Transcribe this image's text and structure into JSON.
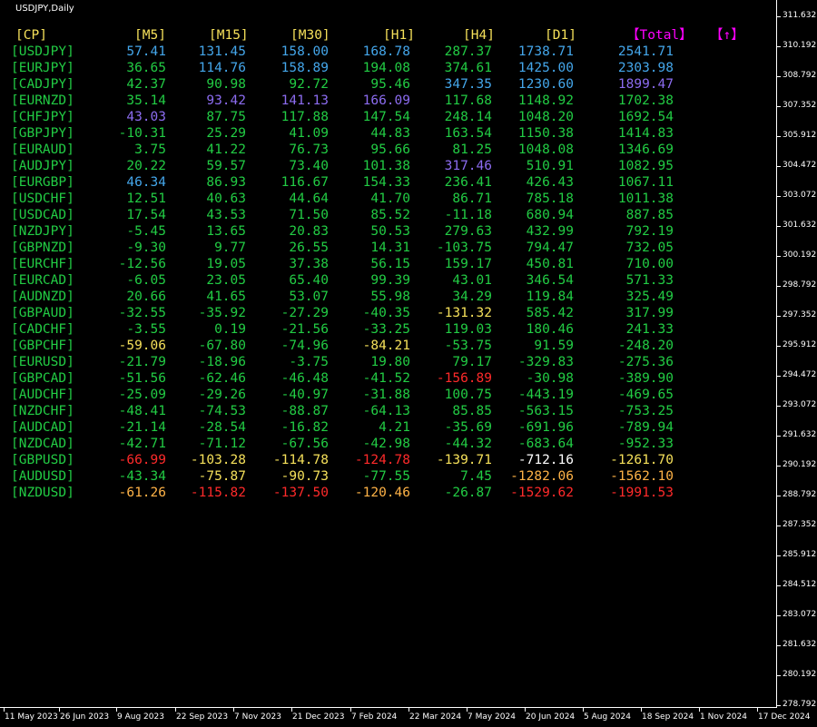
{
  "chart_title": "USDJPY,Daily",
  "colors": {
    "green": "#22cc44",
    "yellow": "#f5e05a",
    "blue": "#44a6ea",
    "purple": "#8c6cf0",
    "red": "#ff2a2a",
    "orange": "#ffb347",
    "magenta": "#ff00ff",
    "white": "#ffffff"
  },
  "headers": [
    {
      "text": "[CP]",
      "color": "yellow"
    },
    {
      "text": "[M5]",
      "color": "yellow"
    },
    {
      "text": "[M15]",
      "color": "yellow"
    },
    {
      "text": "[M30]",
      "color": "yellow"
    },
    {
      "text": "[H1]",
      "color": "yellow"
    },
    {
      "text": "[H4]",
      "color": "yellow"
    },
    {
      "text": "[D1]",
      "color": "yellow"
    },
    {
      "text": "【Total】",
      "color": "magenta"
    },
    {
      "text": "【↑】",
      "color": "magenta"
    }
  ],
  "rows": [
    {
      "sym": "[USDJPY]",
      "v": [
        [
          "57.41",
          "blue"
        ],
        [
          "131.45",
          "blue"
        ],
        [
          "158.00",
          "blue"
        ],
        [
          "168.78",
          "blue"
        ],
        [
          "287.37",
          "green"
        ],
        [
          "1738.71",
          "blue"
        ],
        [
          "2541.71",
          "blue"
        ]
      ]
    },
    {
      "sym": "[EURJPY]",
      "v": [
        [
          "36.65",
          "green"
        ],
        [
          "114.76",
          "blue"
        ],
        [
          "158.89",
          "blue"
        ],
        [
          "194.08",
          "green"
        ],
        [
          "374.61",
          "green"
        ],
        [
          "1425.00",
          "blue"
        ],
        [
          "2303.98",
          "blue"
        ]
      ]
    },
    {
      "sym": "[CADJPY]",
      "v": [
        [
          "42.37",
          "green"
        ],
        [
          "90.98",
          "green"
        ],
        [
          "92.72",
          "green"
        ],
        [
          "95.46",
          "green"
        ],
        [
          "347.35",
          "blue"
        ],
        [
          "1230.60",
          "blue"
        ],
        [
          "1899.47",
          "purple"
        ]
      ]
    },
    {
      "sym": "[EURNZD]",
      "v": [
        [
          "35.14",
          "green"
        ],
        [
          "93.42",
          "purple"
        ],
        [
          "141.13",
          "purple"
        ],
        [
          "166.09",
          "purple"
        ],
        [
          "117.68",
          "green"
        ],
        [
          "1148.92",
          "green"
        ],
        [
          "1702.38",
          "green"
        ]
      ]
    },
    {
      "sym": "[CHFJPY]",
      "v": [
        [
          "43.03",
          "purple"
        ],
        [
          "87.75",
          "green"
        ],
        [
          "117.88",
          "green"
        ],
        [
          "147.54",
          "green"
        ],
        [
          "248.14",
          "green"
        ],
        [
          "1048.20",
          "green"
        ],
        [
          "1692.54",
          "green"
        ]
      ]
    },
    {
      "sym": "[GBPJPY]",
      "v": [
        [
          "-10.31",
          "green"
        ],
        [
          "25.29",
          "green"
        ],
        [
          "41.09",
          "green"
        ],
        [
          "44.83",
          "green"
        ],
        [
          "163.54",
          "green"
        ],
        [
          "1150.38",
          "green"
        ],
        [
          "1414.83",
          "green"
        ]
      ]
    },
    {
      "sym": "[EURAUD]",
      "v": [
        [
          "3.75",
          "green"
        ],
        [
          "41.22",
          "green"
        ],
        [
          "76.73",
          "green"
        ],
        [
          "95.66",
          "green"
        ],
        [
          "81.25",
          "green"
        ],
        [
          "1048.08",
          "green"
        ],
        [
          "1346.69",
          "green"
        ]
      ]
    },
    {
      "sym": "[AUDJPY]",
      "v": [
        [
          "20.22",
          "green"
        ],
        [
          "59.57",
          "green"
        ],
        [
          "73.40",
          "green"
        ],
        [
          "101.38",
          "green"
        ],
        [
          "317.46",
          "purple"
        ],
        [
          "510.91",
          "green"
        ],
        [
          "1082.95",
          "green"
        ]
      ]
    },
    {
      "sym": "[EURGBP]",
      "v": [
        [
          "46.34",
          "blue"
        ],
        [
          "86.93",
          "green"
        ],
        [
          "116.67",
          "green"
        ],
        [
          "154.33",
          "green"
        ],
        [
          "236.41",
          "green"
        ],
        [
          "426.43",
          "green"
        ],
        [
          "1067.11",
          "green"
        ]
      ]
    },
    {
      "sym": "[USDCHF]",
      "v": [
        [
          "12.51",
          "green"
        ],
        [
          "40.63",
          "green"
        ],
        [
          "44.64",
          "green"
        ],
        [
          "41.70",
          "green"
        ],
        [
          "86.71",
          "green"
        ],
        [
          "785.18",
          "green"
        ],
        [
          "1011.38",
          "green"
        ]
      ]
    },
    {
      "sym": "[USDCAD]",
      "v": [
        [
          "17.54",
          "green"
        ],
        [
          "43.53",
          "green"
        ],
        [
          "71.50",
          "green"
        ],
        [
          "85.52",
          "green"
        ],
        [
          "-11.18",
          "green"
        ],
        [
          "680.94",
          "green"
        ],
        [
          "887.85",
          "green"
        ]
      ]
    },
    {
      "sym": "[NZDJPY]",
      "v": [
        [
          "-5.45",
          "green"
        ],
        [
          "13.65",
          "green"
        ],
        [
          "20.83",
          "green"
        ],
        [
          "50.53",
          "green"
        ],
        [
          "279.63",
          "green"
        ],
        [
          "432.99",
          "green"
        ],
        [
          "792.19",
          "green"
        ]
      ]
    },
    {
      "sym": "[GBPNZD]",
      "v": [
        [
          "-9.30",
          "green"
        ],
        [
          "9.77",
          "green"
        ],
        [
          "26.55",
          "green"
        ],
        [
          "14.31",
          "green"
        ],
        [
          "-103.75",
          "green"
        ],
        [
          "794.47",
          "green"
        ],
        [
          "732.05",
          "green"
        ]
      ]
    },
    {
      "sym": "[EURCHF]",
      "v": [
        [
          "-12.56",
          "green"
        ],
        [
          "19.05",
          "green"
        ],
        [
          "37.38",
          "green"
        ],
        [
          "56.15",
          "green"
        ],
        [
          "159.17",
          "green"
        ],
        [
          "450.81",
          "green"
        ],
        [
          "710.00",
          "green"
        ]
      ]
    },
    {
      "sym": "[EURCAD]",
      "v": [
        [
          "-6.05",
          "green"
        ],
        [
          "23.05",
          "green"
        ],
        [
          "65.40",
          "green"
        ],
        [
          "99.39",
          "green"
        ],
        [
          "43.01",
          "green"
        ],
        [
          "346.54",
          "green"
        ],
        [
          "571.33",
          "green"
        ]
      ]
    },
    {
      "sym": "[AUDNZD]",
      "v": [
        [
          "20.66",
          "green"
        ],
        [
          "41.65",
          "green"
        ],
        [
          "53.07",
          "green"
        ],
        [
          "55.98",
          "green"
        ],
        [
          "34.29",
          "green"
        ],
        [
          "119.84",
          "green"
        ],
        [
          "325.49",
          "green"
        ]
      ]
    },
    {
      "sym": "[GBPAUD]",
      "v": [
        [
          "-32.55",
          "green"
        ],
        [
          "-35.92",
          "green"
        ],
        [
          "-27.29",
          "green"
        ],
        [
          "-40.35",
          "green"
        ],
        [
          "-131.32",
          "yellow"
        ],
        [
          "585.42",
          "green"
        ],
        [
          "317.99",
          "green"
        ]
      ]
    },
    {
      "sym": "[CADCHF]",
      "v": [
        [
          "-3.55",
          "green"
        ],
        [
          "0.19",
          "green"
        ],
        [
          "-21.56",
          "green"
        ],
        [
          "-33.25",
          "green"
        ],
        [
          "119.03",
          "green"
        ],
        [
          "180.46",
          "green"
        ],
        [
          "241.33",
          "green"
        ]
      ]
    },
    {
      "sym": "[GBPCHF]",
      "v": [
        [
          "-59.06",
          "yellow"
        ],
        [
          "-67.80",
          "green"
        ],
        [
          "-74.96",
          "green"
        ],
        [
          "-84.21",
          "yellow"
        ],
        [
          "-53.75",
          "green"
        ],
        [
          "91.59",
          "green"
        ],
        [
          "-248.20",
          "green"
        ]
      ]
    },
    {
      "sym": "[EURUSD]",
      "v": [
        [
          "-21.79",
          "green"
        ],
        [
          "-18.96",
          "green"
        ],
        [
          "-3.75",
          "green"
        ],
        [
          "19.80",
          "green"
        ],
        [
          "79.17",
          "green"
        ],
        [
          "-329.83",
          "green"
        ],
        [
          "-275.36",
          "green"
        ]
      ]
    },
    {
      "sym": "[GBPCAD]",
      "v": [
        [
          "-51.56",
          "green"
        ],
        [
          "-62.46",
          "green"
        ],
        [
          "-46.48",
          "green"
        ],
        [
          "-41.52",
          "green"
        ],
        [
          "-156.89",
          "red"
        ],
        [
          "-30.98",
          "green"
        ],
        [
          "-389.90",
          "green"
        ]
      ]
    },
    {
      "sym": "[AUDCHF]",
      "v": [
        [
          "-25.09",
          "green"
        ],
        [
          "-29.26",
          "green"
        ],
        [
          "-40.97",
          "green"
        ],
        [
          "-31.88",
          "green"
        ],
        [
          "100.75",
          "green"
        ],
        [
          "-443.19",
          "green"
        ],
        [
          "-469.65",
          "green"
        ]
      ]
    },
    {
      "sym": "[NZDCHF]",
      "v": [
        [
          "-48.41",
          "green"
        ],
        [
          "-74.53",
          "green"
        ],
        [
          "-88.87",
          "green"
        ],
        [
          "-64.13",
          "green"
        ],
        [
          "85.85",
          "green"
        ],
        [
          "-563.15",
          "green"
        ],
        [
          "-753.25",
          "green"
        ]
      ]
    },
    {
      "sym": "[AUDCAD]",
      "v": [
        [
          "-21.14",
          "green"
        ],
        [
          "-28.54",
          "green"
        ],
        [
          "-16.82",
          "green"
        ],
        [
          "4.21",
          "green"
        ],
        [
          "-35.69",
          "green"
        ],
        [
          "-691.96",
          "green"
        ],
        [
          "-789.94",
          "green"
        ]
      ]
    },
    {
      "sym": "[NZDCAD]",
      "v": [
        [
          "-42.71",
          "green"
        ],
        [
          "-71.12",
          "green"
        ],
        [
          "-67.56",
          "green"
        ],
        [
          "-42.98",
          "green"
        ],
        [
          "-44.32",
          "green"
        ],
        [
          "-683.64",
          "green"
        ],
        [
          "-952.33",
          "green"
        ]
      ]
    },
    {
      "sym": "[GBPUSD]",
      "v": [
        [
          "-66.99",
          "red"
        ],
        [
          "-103.28",
          "yellow"
        ],
        [
          "-114.78",
          "yellow"
        ],
        [
          "-124.78",
          "red"
        ],
        [
          "-139.71",
          "yellow"
        ],
        [
          "-712.16",
          "white"
        ],
        [
          "-1261.70",
          "yellow"
        ]
      ]
    },
    {
      "sym": "[AUDUSD]",
      "v": [
        [
          "-43.34",
          "green"
        ],
        [
          "-75.87",
          "yellow"
        ],
        [
          "-90.73",
          "yellow"
        ],
        [
          "-77.55",
          "green"
        ],
        [
          "7.45",
          "green"
        ],
        [
          "-1282.06",
          "orange"
        ],
        [
          "-1562.10",
          "orange"
        ]
      ]
    },
    {
      "sym": "[NZDUSD]",
      "v": [
        [
          "-61.26",
          "orange"
        ],
        [
          "-115.82",
          "red"
        ],
        [
          "-137.50",
          "red"
        ],
        [
          "-120.46",
          "orange"
        ],
        [
          "-26.87",
          "green"
        ],
        [
          "-1529.62",
          "red"
        ],
        [
          "-1991.53",
          "red"
        ]
      ]
    }
  ],
  "y_axis": [
    "311.632",
    "310.192",
    "308.792",
    "307.352",
    "305.912",
    "304.472",
    "303.072",
    "301.632",
    "300.192",
    "298.792",
    "297.352",
    "295.912",
    "294.472",
    "293.072",
    "291.632",
    "290.192",
    "288.792",
    "287.352",
    "285.912",
    "284.512",
    "283.072",
    "281.632",
    "280.192",
    "278.792"
  ],
  "x_axis": [
    "11 May 2023",
    "26 Jun 2023",
    "9 Aug 2023",
    "22 Sep 2023",
    "7 Nov 2023",
    "21 Dec 2023",
    "7 Feb 2024",
    "22 Mar 2024",
    "7 May 2024",
    "20 Jun 2024",
    "5 Aug 2024",
    "18 Sep 2024",
    "1 Nov 2024",
    "17 Dec 2024"
  ]
}
